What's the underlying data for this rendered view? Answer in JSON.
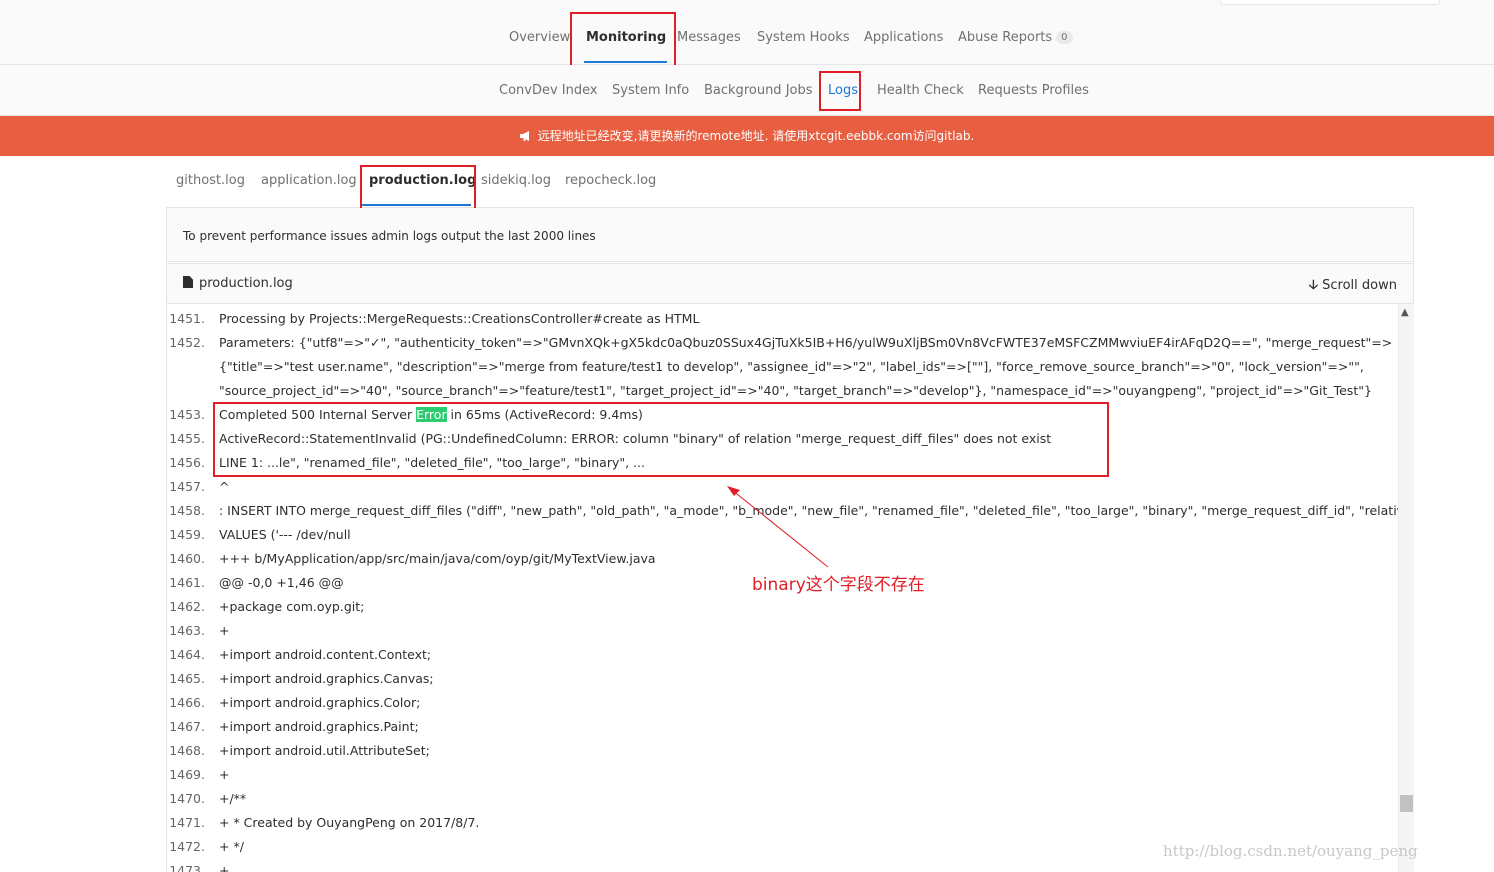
{
  "top_nav": {
    "items": [
      {
        "label": "Overview"
      },
      {
        "label": "Monitoring"
      },
      {
        "label": "Messages"
      },
      {
        "label": "System Hooks"
      },
      {
        "label": "Applications"
      },
      {
        "label": "Abuse Reports",
        "badge": "0"
      }
    ],
    "active": "Monitoring"
  },
  "sub_nav": {
    "items": [
      {
        "label": "ConvDev Index"
      },
      {
        "label": "System Info"
      },
      {
        "label": "Background Jobs"
      },
      {
        "label": "Logs"
      },
      {
        "label": "Health Check"
      },
      {
        "label": "Requests Profiles"
      }
    ],
    "active": "Logs"
  },
  "banner": {
    "text": "远程地址已经改变,请更换新的remote地址. 请使用xtcgit.eebbk.com访问gitlab.",
    "icon": "megaphone-icon",
    "color": "#e75e40"
  },
  "log_tabs": {
    "items": [
      {
        "label": "githost.log"
      },
      {
        "label": "application.log"
      },
      {
        "label": "production.log"
      },
      {
        "label": "sidekiq.log"
      },
      {
        "label": "repocheck.log"
      }
    ],
    "active": "production.log"
  },
  "info_text": "To prevent performance issues admin logs output the last 2000 lines",
  "file_header": {
    "filename": "production.log",
    "file_icon": "file-icon",
    "scroll_label": "Scroll down",
    "scroll_icon": "arrow-down-icon"
  },
  "log_lines": [
    {
      "num": "1451.",
      "text": "Processing by Projects::MergeRequests::CreationsController#create as HTML"
    },
    {
      "num": "1452.",
      "text": "Parameters: {\"utf8\"=>\"✓\", \"authenticity_token\"=>\"GMvnXQk+gX5kdc0aQbuz0SSux4GjTuXk5IB+H6/yulW9uXljBSm0Vn8VcFWTE37eMSFCZMMwviuEF4irAFqD2Q==\", \"merge_request\"=>"
    },
    {
      "num": "",
      "text": "{\"title\"=>\"test user.name\", \"description\"=>\"merge from feature/test1 to develop\", \"assignee_id\"=>\"2\", \"label_ids\"=>[\"\"], \"force_remove_source_branch\"=>\"0\", \"lock_version\"=>\"\","
    },
    {
      "num": "",
      "text": "\"source_project_id\"=>\"40\", \"source_branch\"=>\"feature/test1\", \"target_project_id\"=>\"40\", \"target_branch\"=>\"develop\"}, \"namespace_id\"=>\"ouyangpeng\", \"project_id\"=>\"Git_Test\"}"
    },
    {
      "num": "1453.",
      "text_before": "Completed 500 Internal Server ",
      "highlight": "Error",
      "text_after": " in 65ms (ActiveRecord: 9.4ms)"
    },
    {
      "num": "1455.",
      "text": "ActiveRecord::StatementInvalid (PG::UndefinedColumn: ERROR: column \"binary\" of relation \"merge_request_diff_files\" does not exist"
    },
    {
      "num": "1456.",
      "text": "LINE 1: ...le\", \"renamed_file\", \"deleted_file\", \"too_large\", \"binary\", ..."
    },
    {
      "num": "1457.",
      "text": "^"
    },
    {
      "num": "1458.",
      "text": ": INSERT INTO merge_request_diff_files (\"diff\", \"new_path\", \"old_path\", \"a_mode\", \"b_mode\", \"new_file\", \"renamed_file\", \"deleted_file\", \"too_large\", \"binary\", \"merge_request_diff_id\", \"relative_order\")"
    },
    {
      "num": "1459.",
      "text": "VALUES ('--- /dev/null"
    },
    {
      "num": "1460.",
      "text": "+++ b/MyApplication/app/src/main/java/com/oyp/git/MyTextView.java"
    },
    {
      "num": "1461.",
      "text": "@@ -0,0 +1,46 @@"
    },
    {
      "num": "1462.",
      "text": "+package com.oyp.git;"
    },
    {
      "num": "1463.",
      "text": "+"
    },
    {
      "num": "1464.",
      "text": "+import android.content.Context;"
    },
    {
      "num": "1465.",
      "text": "+import android.graphics.Canvas;"
    },
    {
      "num": "1466.",
      "text": "+import android.graphics.Color;"
    },
    {
      "num": "1467.",
      "text": "+import android.graphics.Paint;"
    },
    {
      "num": "1468.",
      "text": "+import android.util.AttributeSet;"
    },
    {
      "num": "1469.",
      "text": "+"
    },
    {
      "num": "1470.",
      "text": "+/**"
    },
    {
      "num": "1471.",
      "text": "+ * Created by OuyangPeng on 2017/8/7."
    },
    {
      "num": "1472.",
      "text": "+ */"
    },
    {
      "num": "1473.",
      "text": "+"
    }
  ],
  "annotation": {
    "text": "binary这个字段不存在",
    "color": "#e01e26"
  },
  "watermark": "http://blog.csdn.net/ouyang_peng",
  "colors": {
    "accent": "#1f78d1",
    "highlight_box": "#e01e26",
    "error_highlight": "#2ecc71"
  }
}
